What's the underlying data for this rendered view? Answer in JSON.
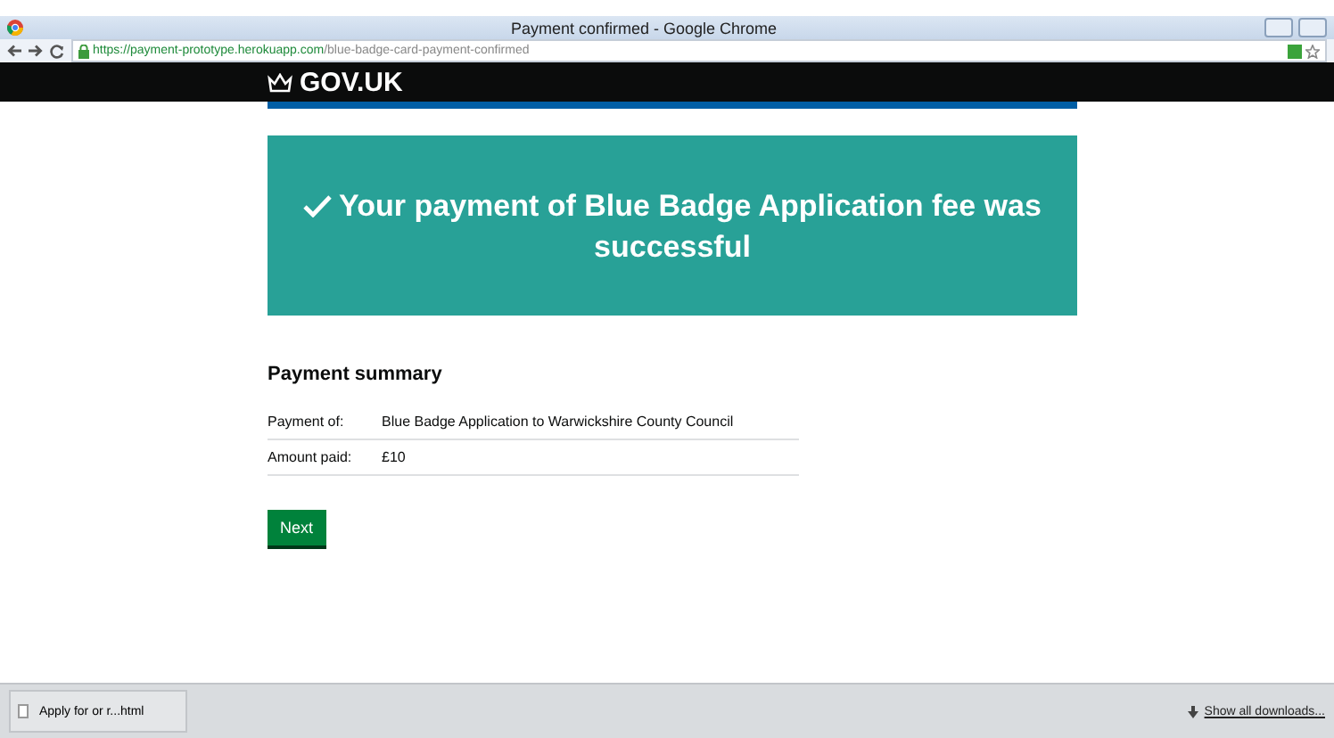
{
  "window": {
    "title": "Payment confirmed - Google Chrome"
  },
  "address_bar": {
    "secure_part": "https://payment-prototype.herokuapp.com",
    "path": "/blue-badge-card-payment-confirmed"
  },
  "header": {
    "logo": "GOV.UK"
  },
  "banner": {
    "message": "Your payment of Blue Badge Application fee was successful"
  },
  "summary": {
    "heading": "Payment summary",
    "rows": [
      {
        "label": "Payment of:",
        "value": "Blue Badge Application to Warwickshire County Council"
      },
      {
        "label": "Amount paid:",
        "value": "£10"
      }
    ]
  },
  "buttons": [
    "Next"
  ],
  "download_bar": {
    "item": "Apply for or r...html",
    "show_all": "Show all downloads..."
  }
}
